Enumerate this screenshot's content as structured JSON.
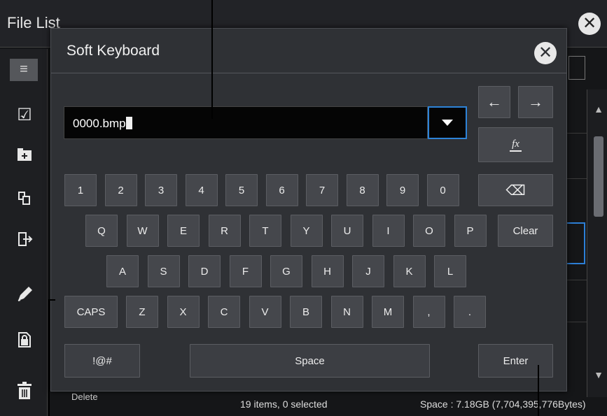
{
  "background_window": {
    "title": "File List",
    "sidebar_delete_label": "Delete",
    "status_items": "19 items, 0 selected",
    "status_space": "Space : 7.18GB (7,704,395,776Bytes)"
  },
  "dialog": {
    "title": "Soft Keyboard",
    "input_value": "0000.bmp",
    "number_row": [
      "1",
      "2",
      "3",
      "4",
      "5",
      "6",
      "7",
      "8",
      "9",
      "0"
    ],
    "row_q": [
      "Q",
      "W",
      "E",
      "R",
      "T",
      "Y",
      "U",
      "I",
      "O",
      "P"
    ],
    "row_a": [
      "A",
      "S",
      "D",
      "F",
      "G",
      "H",
      "J",
      "K",
      "L"
    ],
    "row_z": [
      "Z",
      "X",
      "C",
      "V",
      "B",
      "N",
      "M",
      ",",
      "."
    ],
    "clear_label": "Clear",
    "caps_label": "CAPS",
    "symbols_label": "!@#",
    "space_label": "Space",
    "enter_label": "Enter",
    "left_arrow": "←",
    "right_arrow": "→",
    "fx_label": "fx",
    "backspace_glyph": "⌫",
    "close_glyph": "✕"
  },
  "icons": [
    "menu-icon",
    "check-icon",
    "new-folder-icon",
    "copy-icon",
    "move-icon",
    "rename-pencil-icon",
    "protect-lock-icon",
    "delete-trash-icon"
  ],
  "colors": {
    "accent": "#2d83d8",
    "dialog_bg": "#2f3135",
    "key_bg": "#45474c"
  }
}
